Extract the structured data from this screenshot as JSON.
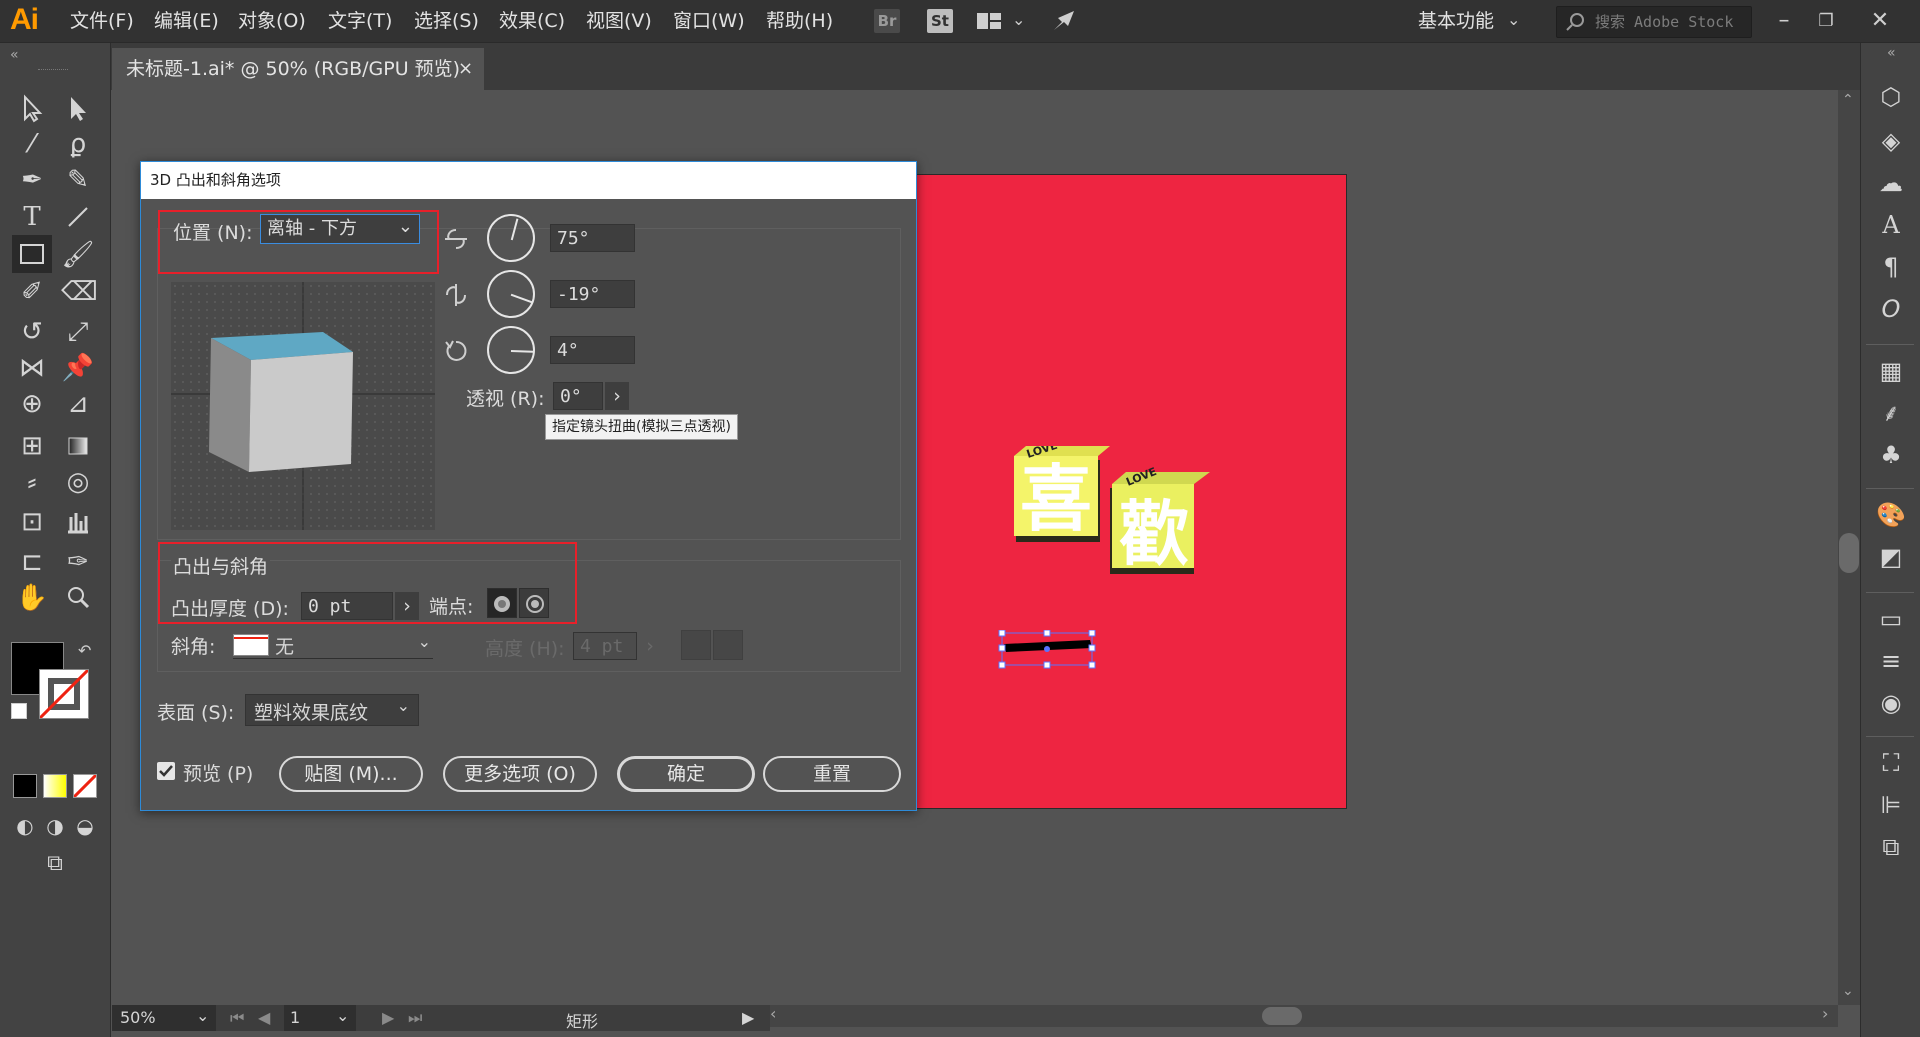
{
  "app": {
    "logo": "Ai"
  },
  "menu": [
    "文件(F)",
    "编辑(E)",
    "对象(O)",
    "文字(T)",
    "选择(S)",
    "效果(C)",
    "视图(V)",
    "窗口(W)",
    "帮助(H)"
  ],
  "app_icons": {
    "bridge": "Br",
    "stock": "St"
  },
  "workspace": {
    "label": "基本功能"
  },
  "search": {
    "placeholder": "搜索 Adobe Stock"
  },
  "document": {
    "tab_title": "未标题-1.ai* @ 50% (RGB/GPU 预览)",
    "close": "×"
  },
  "dialog": {
    "title": "3D 凸出和斜角选项",
    "position_label": "位置 (N):",
    "position_value": "离轴 - 下方",
    "rot_x": "75°",
    "rot_y": "-19°",
    "rot_z": "4°",
    "perspective_label": "透视 (R):",
    "perspective_value": "0°",
    "tooltip": "指定镜头扭曲(模拟三点透视)",
    "extrude_section": "凸出与斜角",
    "extrude_depth_label": "凸出厚度 (D):",
    "extrude_depth_value": "0 pt",
    "cap_label": "端点:",
    "bevel_label": "斜角:",
    "bevel_value": "无",
    "height_label": "高度 (H):",
    "height_value": "4 pt",
    "surface_label": "表面 (S):",
    "surface_value": "塑料效果底纹",
    "preview_label": "预览 (P)",
    "preview_checked": true,
    "map_button": "贴图 (M)...",
    "more_button": "更多选项 (O)",
    "ok_button": "确定",
    "reset_button": "重置"
  },
  "artboard": {
    "background": "#ee2541",
    "text_left": "喜",
    "text_right": "歡",
    "small_label": "LOVE"
  },
  "status": {
    "zoom": "50%",
    "page": "1",
    "object_type": "矩形"
  }
}
